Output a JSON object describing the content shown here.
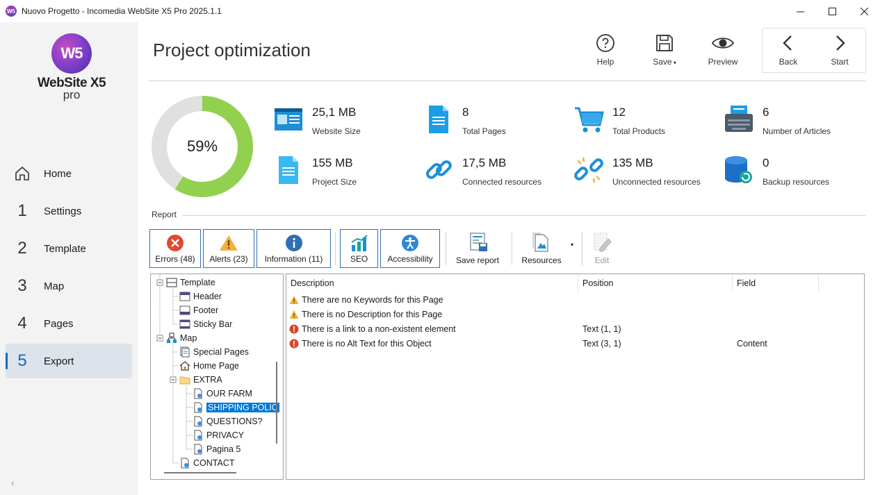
{
  "window": {
    "title": "Nuovo Progetto - Incomedia WebSite X5 Pro 2025.1.1",
    "app_icon_text": "W5"
  },
  "logo": {
    "mark": "W5",
    "name": "WebSite X5",
    "edition": "pro"
  },
  "sidebar": {
    "items": [
      {
        "num": "",
        "label": "Home"
      },
      {
        "num": "1",
        "label": "Settings"
      },
      {
        "num": "2",
        "label": "Template"
      },
      {
        "num": "3",
        "label": "Map"
      },
      {
        "num": "4",
        "label": "Pages"
      },
      {
        "num": "5",
        "label": "Export"
      }
    ],
    "collapse": "‹"
  },
  "header": {
    "title": "Project optimization",
    "help": "Help",
    "save": "Save",
    "preview": "Preview",
    "back": "Back",
    "start": "Start"
  },
  "optimization": {
    "percent": "59%",
    "percent_value": 59
  },
  "stats": {
    "website_size": {
      "value": "25,1 MB",
      "label": "Website Size"
    },
    "total_pages": {
      "value": "8",
      "label": "Total Pages"
    },
    "total_products": {
      "value": "12",
      "label": "Total Products"
    },
    "articles": {
      "value": "6",
      "label": "Number of Articles"
    },
    "project_size": {
      "value": "155 MB",
      "label": "Project Size"
    },
    "connected": {
      "value": "17,5 MB",
      "label": "Connected resources"
    },
    "unconnected": {
      "value": "135 MB",
      "label": "Unconnected resources"
    },
    "backup": {
      "value": "0",
      "label": "Backup resources"
    }
  },
  "report": {
    "title": "Report",
    "errors": "Errors (48)",
    "alerts": "Alerts (23)",
    "information": "Information (11)",
    "seo": "SEO",
    "accessibility": "Accessibility",
    "save_report": "Save report",
    "resources": "Resources",
    "edit": "Edit"
  },
  "tree": {
    "template": "Template",
    "header": "Header",
    "footer": "Footer",
    "sticky": "Sticky Bar",
    "map": "Map",
    "special": "Special Pages",
    "home": "Home Page",
    "extra": "EXTRA",
    "our_farm": "OUR FARM",
    "shipping": "SHIPPING POLIC",
    "questions": "QUESTIONS?",
    "privacy": "PRIVACY",
    "pagina5": "Pagina 5",
    "contact": "CONTACT"
  },
  "messages": {
    "columns": {
      "description": "Description",
      "position": "Position",
      "field": "Field"
    },
    "rows": [
      {
        "type": "alert",
        "description": "There are no Keywords for this Page",
        "position": "",
        "field": ""
      },
      {
        "type": "alert",
        "description": "There is no Description for this Page",
        "position": "",
        "field": ""
      },
      {
        "type": "error",
        "description": "There is a link to a non-existent element",
        "position": "Text (1, 1)",
        "field": ""
      },
      {
        "type": "error",
        "description": "There is no Alt Text for this Object",
        "position": "Text (3, 1)",
        "field": "Content"
      }
    ]
  },
  "colors": {
    "accent": "#0f6cbd",
    "donut_fill": "#92d050",
    "donut_track": "#e0e0e0",
    "error": "#e04a2f",
    "alert": "#f0b23c",
    "info": "#2f6fb3"
  }
}
